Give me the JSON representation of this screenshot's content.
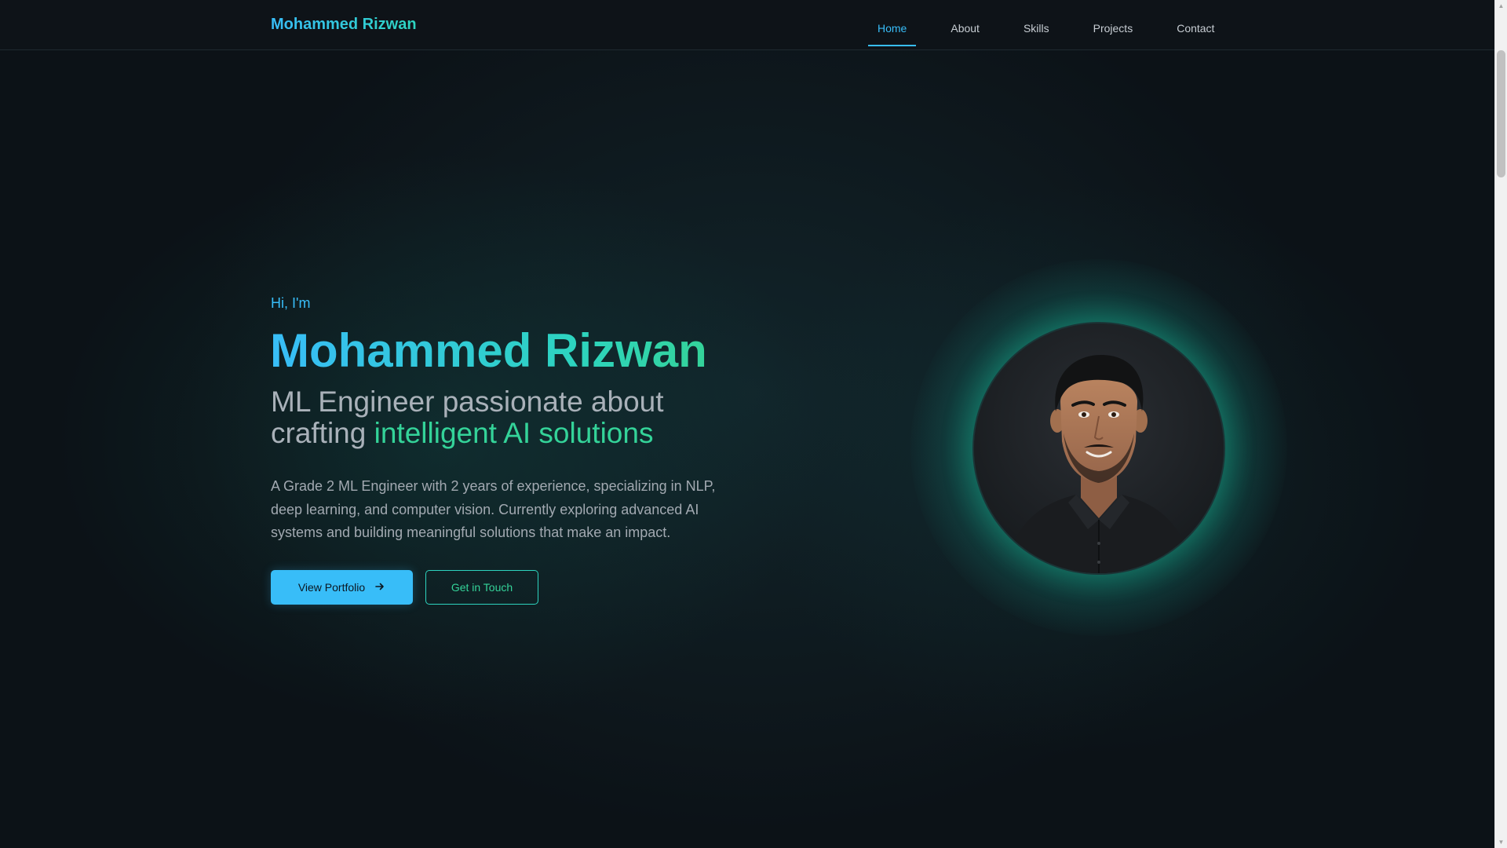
{
  "brand": "Mohammed Rizwan",
  "nav": {
    "items": [
      "Home",
      "About",
      "Skills",
      "Projects",
      "Contact"
    ],
    "active": "Home"
  },
  "hero": {
    "greeting": "Hi, I'm",
    "name": "Mohammed Rizwan",
    "tagline_prefix": "ML Engineer passionate about crafting",
    "tagline_highlight": "intelligent AI solutions",
    "description": "A Grade 2 ML Engineer with 2 years of experience, specializing in NLP, deep learning, and computer vision. Currently exploring advanced AI systems and building meaningful solutions that make an impact.",
    "primary_button": "View Portfolio",
    "secondary_button": "Get in Touch"
  },
  "icons": {
    "primary_button_icon": "arrow-right-icon"
  },
  "colors": {
    "accent_blue": "#38bdf8",
    "accent_green": "#34d399",
    "accent_teal": "#2dd4bf",
    "background": "#0c1217"
  }
}
